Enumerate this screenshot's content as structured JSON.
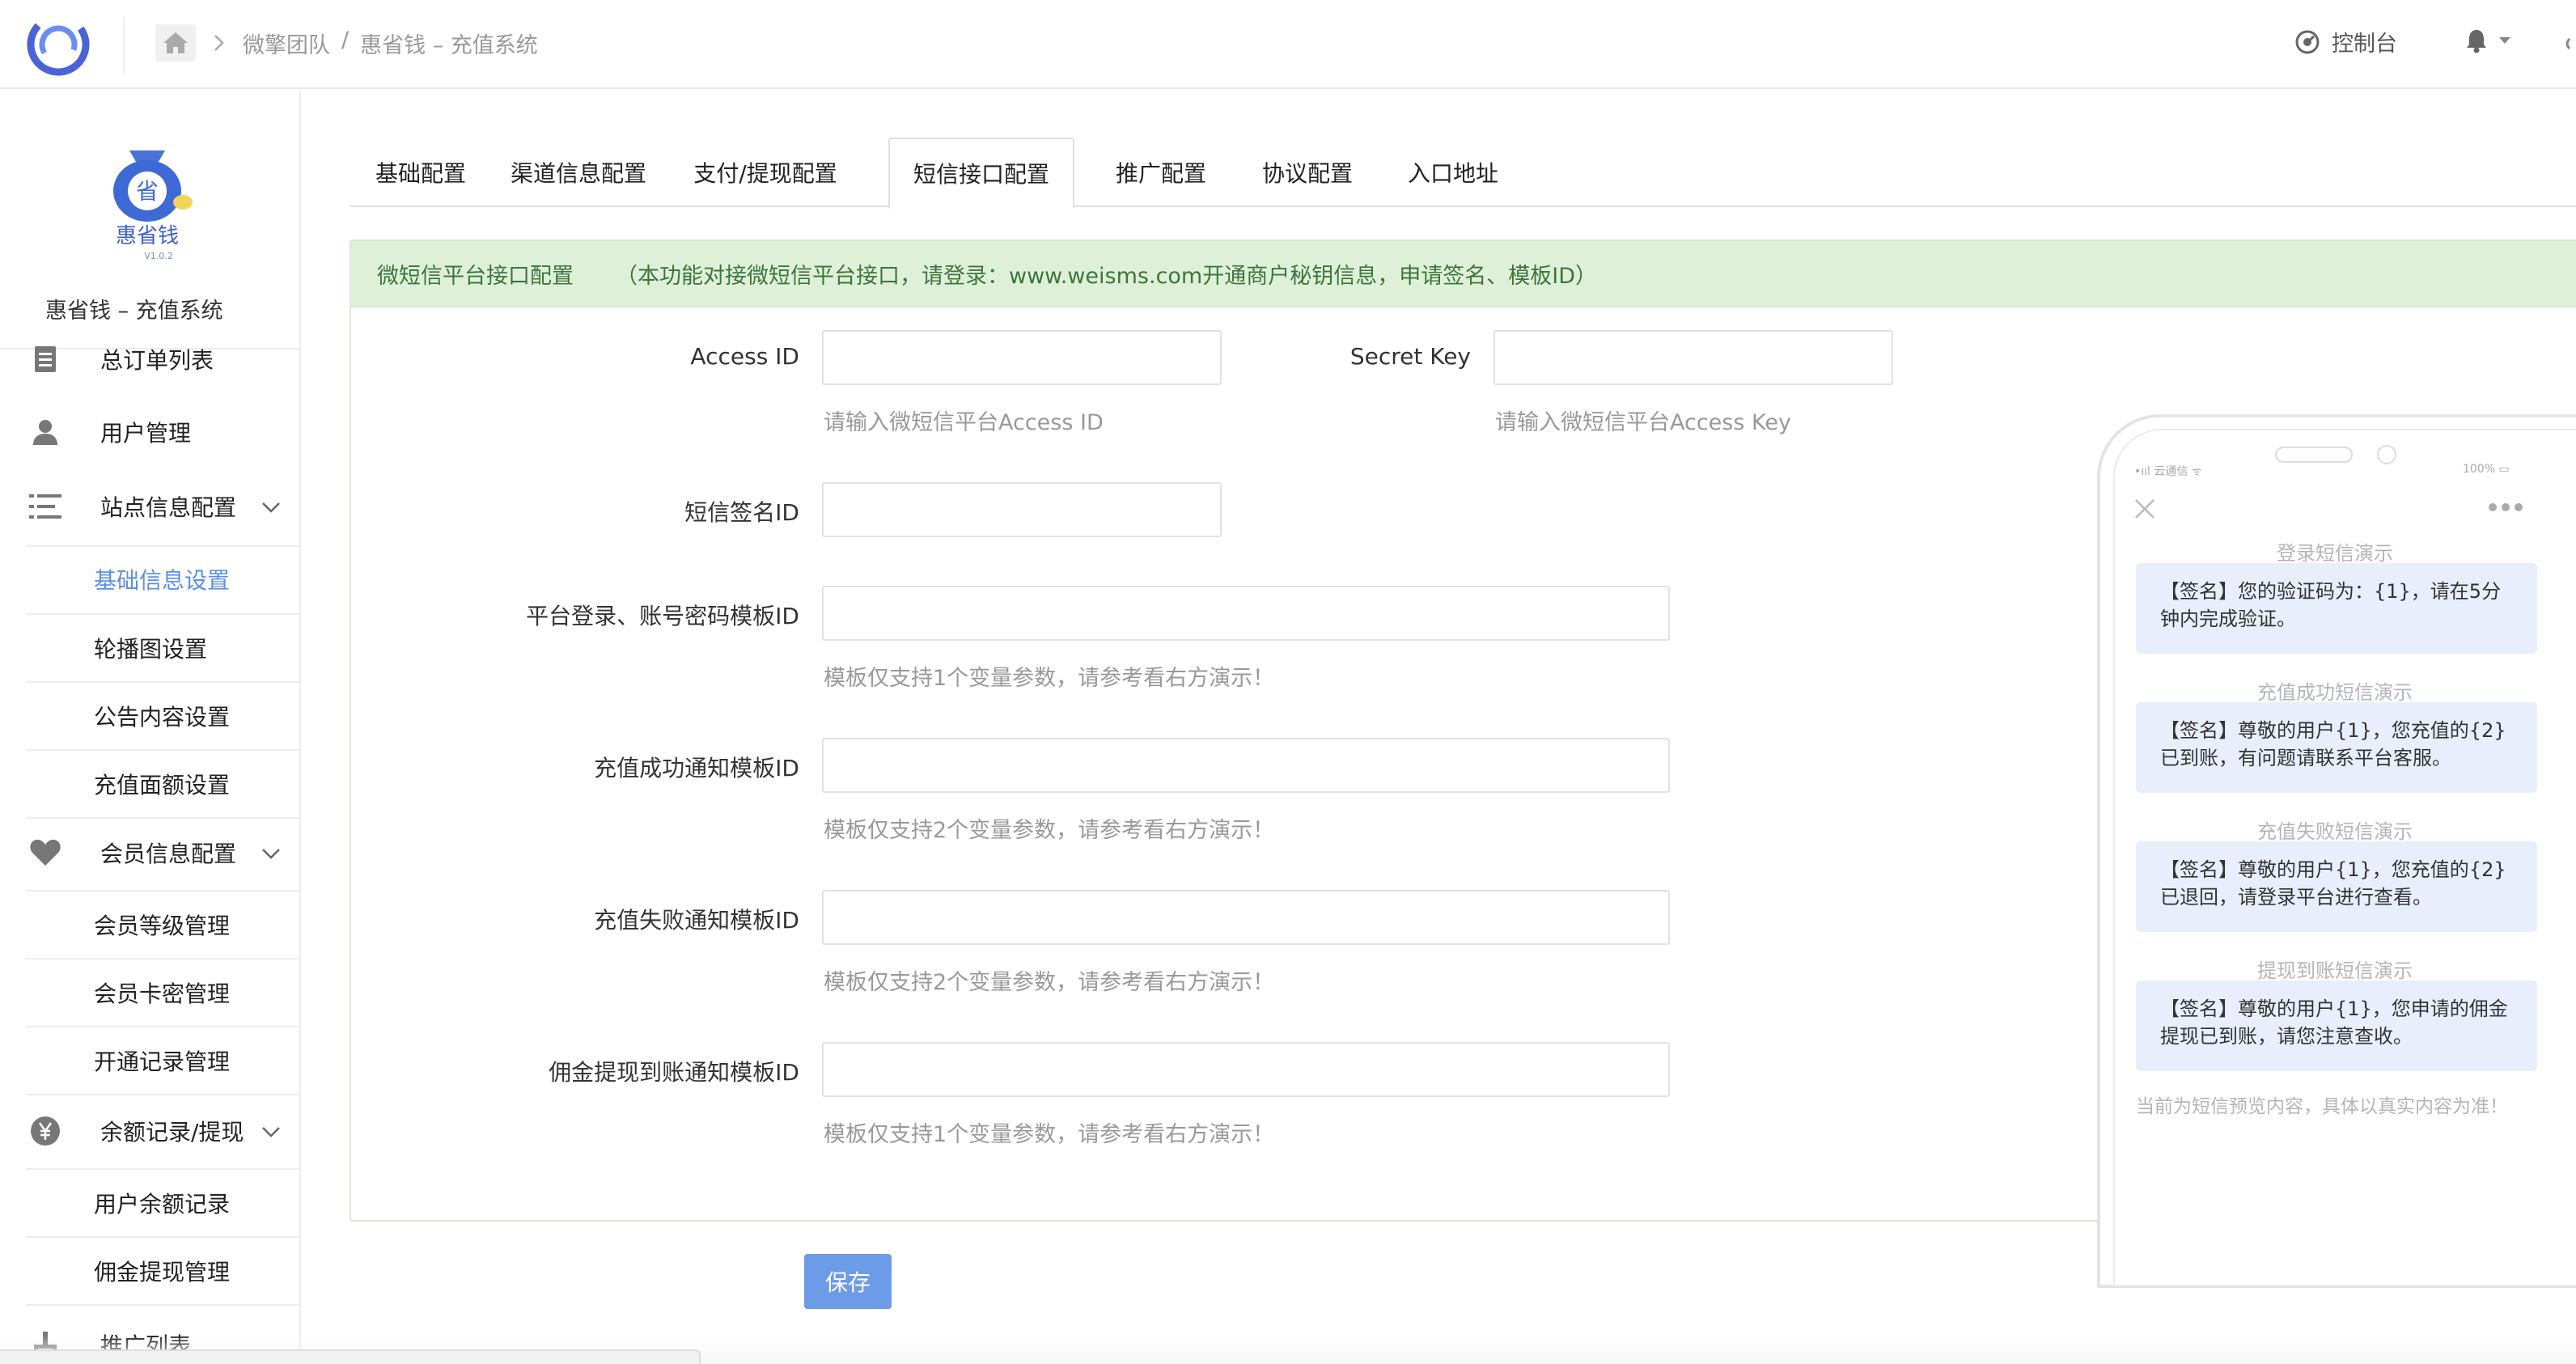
{
  "colors": {
    "accent": "#5b8fe8",
    "save_button": "#6c9be8",
    "notice_bg": "#dff0d8",
    "notice_text": "#3c763d",
    "bubble_bg": "#e8eefb",
    "help_text": "#999999"
  },
  "header": {
    "breadcrumb": [
      "微擎团队",
      "惠省钱 – 充值系统"
    ],
    "breadcrumb_separator": "/",
    "console_label": "控制台",
    "icons": [
      "app-logo-icon",
      "home-icon",
      "chevron-right-icon",
      "dashboard-icon",
      "bell-icon",
      "caret-down-icon"
    ]
  },
  "sidebar": {
    "brand_name": "惠省钱 – 充值系统",
    "logo": {
      "glyph": "省",
      "text": "惠省钱",
      "version": "V1.0.2"
    },
    "items": [
      {
        "label": "总订单列表",
        "icon": "order-list-icon"
      },
      {
        "label": "用户管理",
        "icon": "user-icon"
      },
      {
        "label": "站点信息配置",
        "icon": "menu-lines-icon",
        "expandable": true,
        "children": [
          "基础信息设置",
          "轮播图设置",
          "公告内容设置",
          "充值面额设置"
        ],
        "active_child": "基础信息设置"
      },
      {
        "label": "会员信息配置",
        "icon": "heart-icon",
        "expandable": true,
        "children": [
          "会员等级管理",
          "会员卡密管理",
          "开通记录管理"
        ]
      },
      {
        "label": "余额记录/提现",
        "icon": "yen-icon",
        "expandable": true,
        "children": [
          "用户余额记录",
          "佣金提现管理"
        ]
      },
      {
        "label": "推广列表",
        "icon": "share-icon"
      }
    ]
  },
  "tabs": [
    {
      "label": "基础配置",
      "active": false
    },
    {
      "label": "渠道信息配置",
      "active": false
    },
    {
      "label": "支付/提现配置",
      "active": false
    },
    {
      "label": "短信接口配置",
      "active": true
    },
    {
      "label": "推广配置",
      "active": false
    },
    {
      "label": "协议配置",
      "active": false
    },
    {
      "label": "入口地址",
      "active": false
    }
  ],
  "notice": {
    "title": "微短信平台接口配置",
    "text": "（本功能对接微短信平台接口，请登录：www.weisms.com开通商户秘钥信息，申请签名、模板ID）"
  },
  "form": {
    "access_id": {
      "label": "Access ID",
      "value": "",
      "help": "请输入微短信平台Access ID"
    },
    "secret_key": {
      "label": "Secret Key",
      "value": "",
      "help": "请输入微短信平台Access Key"
    },
    "sign_id": {
      "label": "短信签名ID",
      "value": ""
    },
    "login_tpl": {
      "label": "平台登录、账号密码模板ID",
      "value": "",
      "help": "模板仅支持1个变量参数，请参考看右方演示！"
    },
    "recharge_ok_tpl": {
      "label": "充值成功通知模板ID",
      "value": "",
      "help": "模板仅支持2个变量参数，请参考看右方演示！"
    },
    "recharge_fail_tpl": {
      "label": "充值失败通知模板ID",
      "value": "",
      "help": "模板仅支持2个变量参数，请参考看右方演示！"
    },
    "withdraw_tpl": {
      "label": "佣金提现到账通知模板ID",
      "value": "",
      "help": "模板仅支持1个变量参数，请参考看右方演示！"
    },
    "save_label": "保存"
  },
  "preview": {
    "status_left": "•ııl 云通信 ᯤ",
    "status_right": "100% ▭",
    "messages": [
      {
        "caption": "登录短信演示",
        "text": "【签名】您的验证码为：{1}，请在5分钟内完成验证。"
      },
      {
        "caption": "充值成功短信演示",
        "text": "【签名】尊敬的用户{1}，您充值的{2}已到账，有问题请联系平台客服。"
      },
      {
        "caption": "充值失败短信演示",
        "text": "【签名】尊敬的用户{1}，您充值的{2}已退回，请登录平台进行查看。"
      },
      {
        "caption": "提现到账短信演示",
        "text": "【签名】尊敬的用户{1}，您申请的佣金提现已到账，请您注意查收。"
      }
    ],
    "footer": "当前为短信预览内容，具体以真实内容为准！"
  }
}
